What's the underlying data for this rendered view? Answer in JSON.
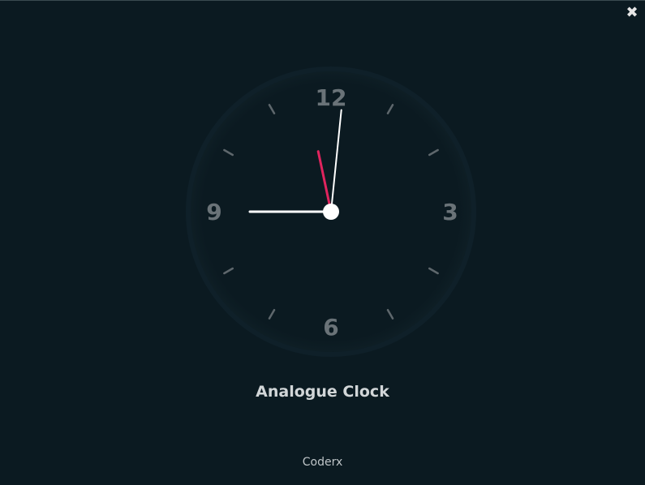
{
  "window": {
    "close_symbol": "✖"
  },
  "clock": {
    "title": "Analogue Clock",
    "numerals": {
      "twelve": "12",
      "three": "3",
      "six": "6",
      "nine": "9"
    },
    "time": {
      "hours": 9,
      "minutes": 0,
      "seconds": 58
    },
    "colors": {
      "background": "#0b1a21",
      "face": "#0b1a21",
      "numeral": "#6a7378",
      "tick": "#5e676c",
      "hand": "#ffffff",
      "second_hand": "#e0245e"
    }
  },
  "footer": {
    "credit": "Coderx"
  }
}
